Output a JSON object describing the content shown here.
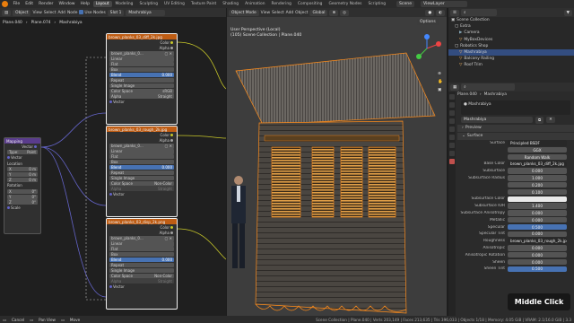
{
  "menu": {
    "items": [
      "File",
      "Edit",
      "Render",
      "Window",
      "Help"
    ]
  },
  "workspace_tabs": [
    "Layout",
    "Modeling",
    "Sculpting",
    "UV Editing",
    "Texture Paint",
    "Shading",
    "Animation",
    "Rendering",
    "Compositing",
    "Geometry Nodes",
    "Scripting"
  ],
  "scene": {
    "label": "Scene",
    "view_layer": "ViewLayer"
  },
  "node_header": {
    "mode": "Object",
    "menus": [
      "View",
      "Select",
      "Add",
      "Node"
    ],
    "use_nodes": "Use Nodes",
    "slot": "Slot 1",
    "material": "Mashrabiya"
  },
  "breadcrumb": [
    "Plane.040",
    "Plane.074",
    "Mashrabiya"
  ],
  "nodes": {
    "mapping": {
      "title": "Mapping",
      "vector_out": "Vector",
      "type_label": "Type:",
      "type_value": "Point",
      "vector_in": "Vector",
      "location": "Location",
      "loc": [
        "0 m",
        "0 m",
        "0 m"
      ],
      "rotation": "Rotation",
      "rot": [
        "0°",
        "0°",
        "0°"
      ],
      "scale": "Scale"
    },
    "tex1": {
      "title": "brown_planks_03_diff_2k.jpg",
      "color": "Color",
      "alpha": "Alpha",
      "file": "brown_planks_0...",
      "linear": "Linear",
      "flat": "Flat",
      "box": "Box",
      "blend": "Blend",
      "blend_val": "0.000",
      "repeat": "Repeat",
      "single": "Single Image",
      "cs_label": "Color Space",
      "cs_value": "sRGB",
      "alpha_label": "Alpha",
      "alpha_value": "Straight",
      "vector": "Vector"
    },
    "tex2": {
      "title": "brown_planks_03_rough_2k.jpg",
      "color": "Color",
      "alpha": "Alpha",
      "file": "brown_planks_0...",
      "linear": "Linear",
      "flat": "Flat",
      "box": "Box",
      "blend": "Blend",
      "blend_val": "0.000",
      "repeat": "Repeat",
      "single": "Single Image",
      "cs_label": "Color Space",
      "cs_value": "Non-Color",
      "alpha_label": "Alpha",
      "alpha_value": "Straight",
      "vector": "Vector"
    },
    "tex3": {
      "title": "brown_planks_03_disp_2k.png",
      "color": "Color",
      "alpha": "Alpha",
      "file": "brown_planks_0...",
      "linear": "Linear",
      "flat": "Flat",
      "box": "Box",
      "blend": "Blend",
      "blend_val": "0.000",
      "repeat": "Repeat",
      "single": "Single Image",
      "cs_label": "Color Space",
      "cs_value": "Non-Color",
      "alpha_label": "Alpha",
      "alpha_value": "Straight",
      "vector": "Vector"
    }
  },
  "viewport": {
    "menus": [
      "View",
      "Select",
      "Add",
      "Object"
    ],
    "mode": "Object Mode",
    "transform": "Global",
    "perspective": "User Perspective (Local)",
    "collection": "(105) Scene Collection | Plane.040",
    "options": "Options"
  },
  "outliner": {
    "title": "Scene",
    "rows": [
      "Scene Collection",
      "Extra",
      "Camera",
      "MyBoxDevices",
      "Robotics Shop",
      "Mashrabiya",
      "Balcony Railing",
      "Roof Trim"
    ]
  },
  "properties": {
    "object": "Plane.040",
    "material_tab": "Mashrabiya",
    "slot": "Mashrabiya",
    "mat_name": "Mashrabiya",
    "preview": "Preview",
    "surface": "Surface",
    "surface_label": "Surface",
    "surface_value": "Principled BSDF",
    "distribution": "GGX",
    "subsurface_method": "Random Walk",
    "rows": [
      {
        "label": "Base Color",
        "value": "brown_planks_03_diff_2k.jpg",
        "style": "dd"
      },
      {
        "label": "Subsurface",
        "value": "0.000",
        "style": "num"
      },
      {
        "label": "Subsurface Radius",
        "value": "1.000",
        "style": "num"
      },
      {
        "label": "",
        "value": "0.200",
        "style": "num"
      },
      {
        "label": "",
        "value": "0.100",
        "style": "num"
      },
      {
        "label": "Subsurface Color",
        "value": "",
        "style": "white"
      },
      {
        "label": "Subsurface IOR",
        "value": "1.400",
        "style": "num"
      },
      {
        "label": "Subsurface Anisotropy",
        "value": "0.000",
        "style": "num"
      },
      {
        "label": "Metallic",
        "value": "0.000",
        "style": "num"
      },
      {
        "label": "Specular",
        "value": "0.500",
        "style": "blue"
      },
      {
        "label": "Specular Tint",
        "value": "0.000",
        "style": "num"
      },
      {
        "label": "Roughness",
        "value": "brown_planks_03_rough_2k.jpg",
        "style": "dd"
      },
      {
        "label": "Anisotropic",
        "value": "0.000",
        "style": "num"
      },
      {
        "label": "Anisotropic Rotation",
        "value": "0.000",
        "style": "num"
      },
      {
        "label": "Sheen",
        "value": "0.000",
        "style": "num"
      },
      {
        "label": "Sheen Tint",
        "value": "0.500",
        "style": "blue"
      }
    ]
  },
  "status": {
    "items": [
      "Cancel",
      "Pan View",
      "Move"
    ],
    "info": "Scene Collection | Plane.040 | Verts 203,149 | Faces 213,635 | Tris 396,033 | Objects 1/18 | Memory: 4.05 GiB | VRAM: 2.1/16.0 GiB | 3.3"
  },
  "overlay": {
    "hint": "Middle Click"
  },
  "colors": {
    "accent": "#4772b3",
    "texture_header": "#bf5d14",
    "selected_edge": "#ff8c1a"
  }
}
